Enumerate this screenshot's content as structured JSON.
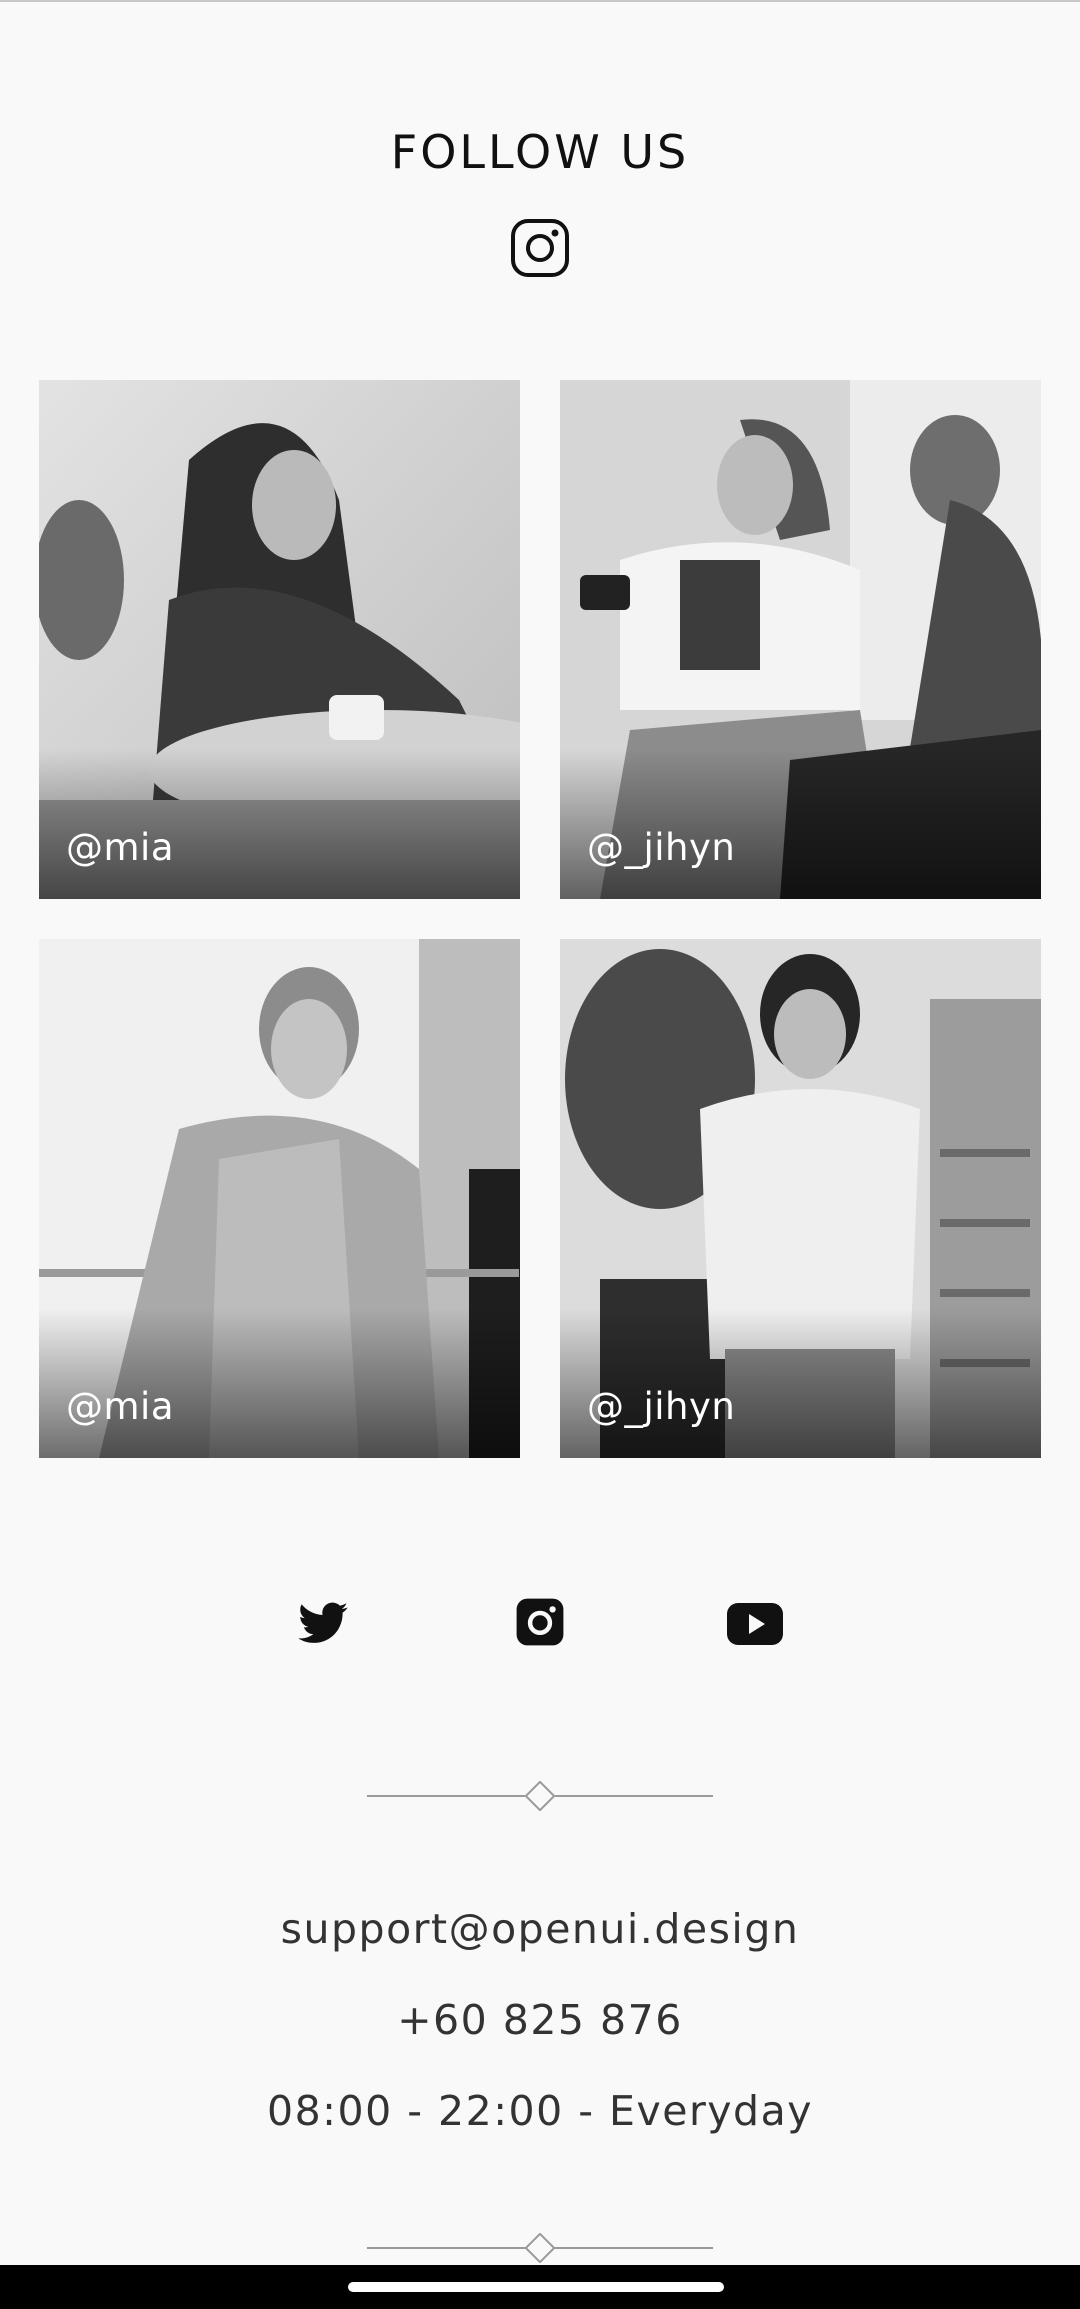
{
  "follow": {
    "title": "FOLLOW US",
    "icon": "instagram-icon"
  },
  "gallery": [
    {
      "handle": "@mia"
    },
    {
      "handle": "@_jihyn"
    },
    {
      "handle": "@mia"
    },
    {
      "handle": "@_jihyn"
    }
  ],
  "social": [
    {
      "icon": "twitter-icon"
    },
    {
      "icon": "instagram-icon"
    },
    {
      "icon": "youtube-icon"
    }
  ],
  "contact": {
    "email": "support@openui.design",
    "phone": "+60 825 876",
    "hours": "08:00 - 22:00 - Everyday"
  },
  "colors": {
    "background": "#f9f9f9",
    "text": "#111111",
    "contact_text": "#333333",
    "divider": "#9a9a9a"
  }
}
